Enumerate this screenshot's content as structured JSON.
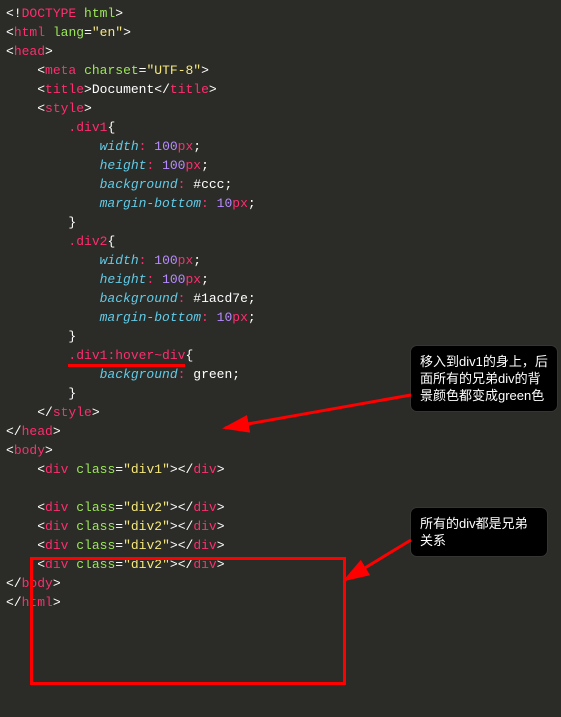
{
  "code": {
    "doctype_bang": "<!",
    "doctype_word": "DOCTYPE",
    "doctype_html": "html",
    "lt": "<",
    "gt": ">",
    "lt_close": "</",
    "tag_html": "html",
    "attr_lang": "lang",
    "val_lang": "\"en\"",
    "tag_head": "head",
    "tag_meta": "meta",
    "attr_charset": "charset",
    "val_charset": "\"UTF-8\"",
    "tag_title": "title",
    "title_text": "Document",
    "tag_style": "style",
    "sel_div1": ".div1",
    "sel_div1_full": ".div1{",
    "prop_width": "width",
    "val_100": "100",
    "unit_px": "px",
    "prop_height": "height",
    "prop_background": "background",
    "val_ccc": "#ccc",
    "prop_margin_bottom": "margin-bottom",
    "val_10": "10",
    "sel_div2": ".div2",
    "val_1acd7e": "#1acd7e",
    "sel_hover_a": ".div1",
    "sel_hover_b": ":hover~",
    "sel_hover_c": "div",
    "val_green": "green",
    "tag_body": "body",
    "tag_div": "div",
    "attr_class": "class",
    "val_div1": "\"div1\"",
    "val_div2": "\"div2\"",
    "brace_open": "{",
    "brace_close": "}",
    "semi": ";",
    "colon": ":",
    "eq": "="
  },
  "callouts": {
    "top": "移入到div1的身上，后面所有的兄弟div的背景颜色都变成green色",
    "bottom": "所有的div都是兄弟关系"
  }
}
